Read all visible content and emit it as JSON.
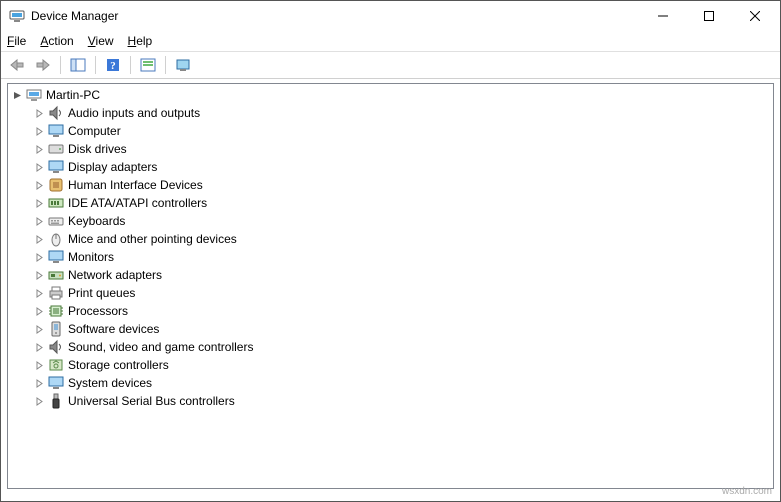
{
  "window": {
    "title": "Device Manager"
  },
  "menu": {
    "file": "File",
    "action": "Action",
    "view": "View",
    "help": "Help"
  },
  "tree": {
    "root": "Martin-PC",
    "items": [
      {
        "label": "Audio inputs and outputs",
        "icon": "speaker"
      },
      {
        "label": "Computer",
        "icon": "monitor"
      },
      {
        "label": "Disk drives",
        "icon": "disk"
      },
      {
        "label": "Display adapters",
        "icon": "monitor"
      },
      {
        "label": "Human Interface Devices",
        "icon": "hid"
      },
      {
        "label": "IDE ATA/ATAPI controllers",
        "icon": "ide"
      },
      {
        "label": "Keyboards",
        "icon": "keyboard"
      },
      {
        "label": "Mice and other pointing devices",
        "icon": "mouse"
      },
      {
        "label": "Monitors",
        "icon": "monitor"
      },
      {
        "label": "Network adapters",
        "icon": "network"
      },
      {
        "label": "Print queues",
        "icon": "printer"
      },
      {
        "label": "Processors",
        "icon": "cpu"
      },
      {
        "label": "Software devices",
        "icon": "software"
      },
      {
        "label": "Sound, video and game controllers",
        "icon": "speaker"
      },
      {
        "label": "Storage controllers",
        "icon": "storage"
      },
      {
        "label": "System devices",
        "icon": "monitor"
      },
      {
        "label": "Universal Serial Bus controllers",
        "icon": "usb"
      }
    ]
  },
  "watermark": "wsxdn.com"
}
